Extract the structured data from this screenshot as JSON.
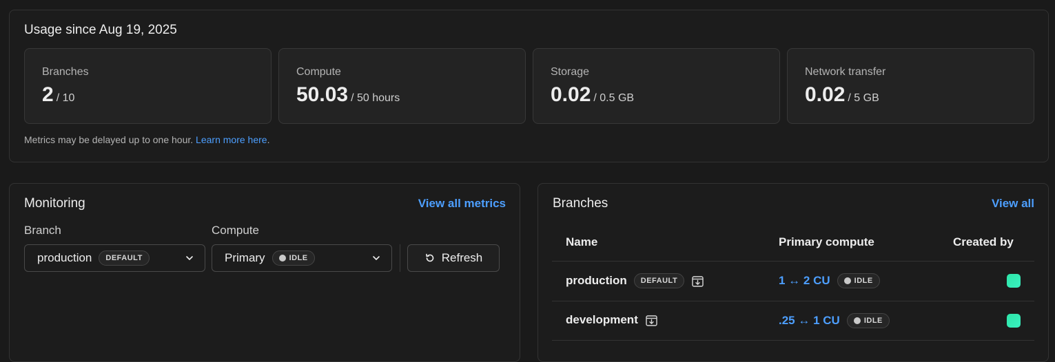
{
  "usage": {
    "title": "Usage since Aug 19, 2025",
    "stats": [
      {
        "label": "Branches",
        "value": "2",
        "limit": "/ 10"
      },
      {
        "label": "Compute",
        "value": "50.03",
        "limit": "/ 50 hours"
      },
      {
        "label": "Storage",
        "value": "0.02",
        "limit": "/ 0.5 GB"
      },
      {
        "label": "Network transfer",
        "value": "0.02",
        "limit": "/ 5 GB"
      }
    ],
    "note": "Metrics may be delayed up to one hour.",
    "note_link": "Learn more here",
    "note_end": "."
  },
  "monitoring": {
    "title": "Monitoring",
    "view_all": "View all metrics",
    "branch_label": "Branch",
    "branch_value": "production",
    "branch_badge": "DEFAULT",
    "compute_label": "Compute",
    "compute_value": "Primary",
    "compute_badge": "IDLE",
    "refresh_label": "Refresh"
  },
  "branches": {
    "title": "Branches",
    "view_all": "View all",
    "columns": [
      "Name",
      "Primary compute",
      "Created by"
    ],
    "rows": [
      {
        "name": "production",
        "badge": "DEFAULT",
        "compute": "1 ↔ 2 CU",
        "status": "IDLE"
      },
      {
        "name": "development",
        "compute": ".25 ↔ 1 CU",
        "status": "IDLE"
      }
    ]
  },
  "colors": {
    "accent": "#4d9fff",
    "avatar": "#2ee6a8",
    "background": "#1a1a1a"
  },
  "icons": [
    "chevron-down-icon",
    "refresh-icon",
    "archive-download-icon",
    "status-dot-icon"
  ]
}
